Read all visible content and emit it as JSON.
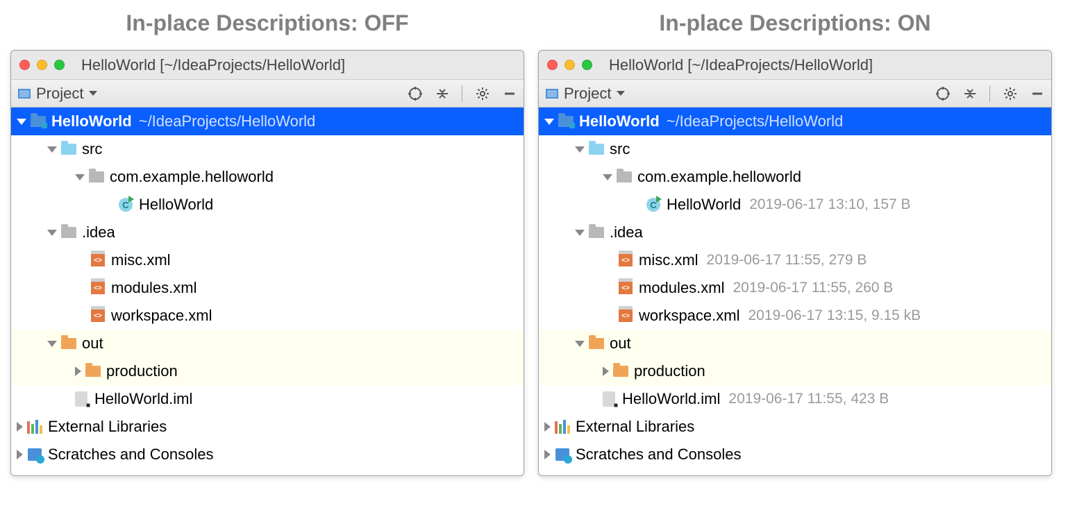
{
  "panels": [
    {
      "caption": "In-place Descriptions: OFF",
      "window_title": "HelloWorld [~/IdeaProjects/HelloWorld]",
      "panel_label": "Project",
      "rows": [
        {
          "indent": 8,
          "arrow": "down",
          "icon": "module",
          "bold": true,
          "name": "HelloWorld",
          "subpath": "~/IdeaProjects/HelloWorld",
          "sel": true
        },
        {
          "indent": 52,
          "arrow": "down",
          "icon": "src",
          "name": "src"
        },
        {
          "indent": 92,
          "arrow": "down",
          "icon": "grey",
          "name": "com.example.helloworld"
        },
        {
          "indent": 134,
          "arrow": "none",
          "icon": "class",
          "name": "HelloWorld"
        },
        {
          "indent": 52,
          "arrow": "down",
          "icon": "grey",
          "name": ".idea"
        },
        {
          "indent": 94,
          "arrow": "none",
          "icon": "xml",
          "name": "misc.xml"
        },
        {
          "indent": 94,
          "arrow": "none",
          "icon": "xml",
          "name": "modules.xml"
        },
        {
          "indent": 94,
          "arrow": "none",
          "icon": "xml",
          "name": "workspace.xml"
        },
        {
          "indent": 52,
          "arrow": "down",
          "icon": "orange",
          "name": "out",
          "hl": true
        },
        {
          "indent": 92,
          "arrow": "right",
          "icon": "orange",
          "name": "production",
          "hl": true
        },
        {
          "indent": 70,
          "arrow": "none",
          "icon": "iml",
          "name": "HelloWorld.iml"
        },
        {
          "indent": 8,
          "arrow": "right",
          "icon": "lib",
          "name": "External Libraries"
        },
        {
          "indent": 8,
          "arrow": "right",
          "icon": "scratch",
          "name": "Scratches and Consoles"
        }
      ]
    },
    {
      "caption": "In-place Descriptions: ON",
      "window_title": "HelloWorld [~/IdeaProjects/HelloWorld]",
      "panel_label": "Project",
      "rows": [
        {
          "indent": 8,
          "arrow": "down",
          "icon": "module",
          "bold": true,
          "name": "HelloWorld",
          "subpath": "~/IdeaProjects/HelloWorld",
          "sel": true
        },
        {
          "indent": 52,
          "arrow": "down",
          "icon": "src",
          "name": "src"
        },
        {
          "indent": 92,
          "arrow": "down",
          "icon": "grey",
          "name": "com.example.helloworld"
        },
        {
          "indent": 134,
          "arrow": "none",
          "icon": "class",
          "name": "HelloWorld",
          "desc": "2019-06-17 13:10, 157 B"
        },
        {
          "indent": 52,
          "arrow": "down",
          "icon": "grey",
          "name": ".idea"
        },
        {
          "indent": 94,
          "arrow": "none",
          "icon": "xml",
          "name": "misc.xml",
          "desc": "2019-06-17 11:55, 279 B"
        },
        {
          "indent": 94,
          "arrow": "none",
          "icon": "xml",
          "name": "modules.xml",
          "desc": "2019-06-17 11:55, 260 B"
        },
        {
          "indent": 94,
          "arrow": "none",
          "icon": "xml",
          "name": "workspace.xml",
          "desc": "2019-06-17 13:15, 9.15 kB"
        },
        {
          "indent": 52,
          "arrow": "down",
          "icon": "orange",
          "name": "out",
          "hl": true
        },
        {
          "indent": 92,
          "arrow": "right",
          "icon": "orange",
          "name": "production",
          "hl": true
        },
        {
          "indent": 70,
          "arrow": "none",
          "icon": "iml",
          "name": "HelloWorld.iml",
          "desc": "2019-06-17 11:55, 423 B"
        },
        {
          "indent": 8,
          "arrow": "right",
          "icon": "lib",
          "name": "External Libraries"
        },
        {
          "indent": 8,
          "arrow": "right",
          "icon": "scratch",
          "name": "Scratches and Consoles"
        }
      ]
    }
  ]
}
